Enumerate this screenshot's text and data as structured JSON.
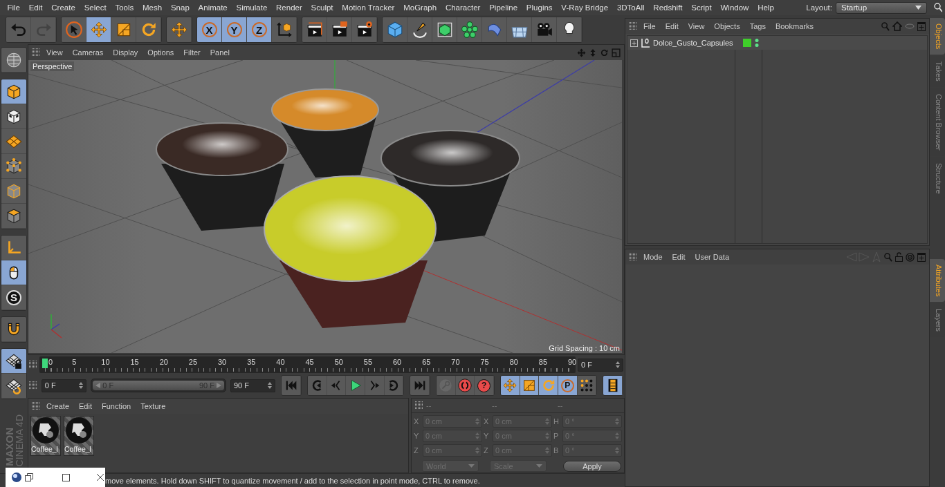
{
  "menu_bar": {
    "items": [
      "File",
      "Edit",
      "Create",
      "Select",
      "Tools",
      "Mesh",
      "Snap",
      "Animate",
      "Simulate",
      "Render",
      "Sculpt",
      "Motion Tracker",
      "MoGraph",
      "Character",
      "Pipeline",
      "Plugins",
      "V-Ray Bridge",
      "3DToAll",
      "Redshift",
      "Script",
      "Window",
      "Help"
    ],
    "layout_label": "Layout:",
    "layout_value": "Startup"
  },
  "toolbar": {
    "groups": [
      {
        "tools": [
          {
            "kind": "undo",
            "selected": false,
            "disabled": false
          },
          {
            "kind": "redo",
            "selected": false,
            "disabled": true
          }
        ]
      },
      {
        "tools": [
          {
            "kind": "pointer",
            "selected": false,
            "disabled": false
          },
          {
            "kind": "move",
            "selected": true,
            "disabled": false
          },
          {
            "kind": "scale",
            "selected": false,
            "disabled": false
          },
          {
            "kind": "rotate",
            "selected": false,
            "disabled": false
          }
        ]
      },
      {
        "tools": [
          {
            "kind": "move-alt",
            "selected": false,
            "disabled": false
          }
        ]
      },
      {
        "tools": [
          {
            "kind": "axis-lock",
            "label": "X",
            "selected": true,
            "disabled": false
          },
          {
            "kind": "axis-lock",
            "label": "Y",
            "selected": true,
            "disabled": false
          },
          {
            "kind": "axis-lock",
            "label": "Z",
            "selected": true,
            "disabled": false
          },
          {
            "kind": "coord-system",
            "selected": false,
            "disabled": false
          }
        ]
      },
      {
        "tools": [
          {
            "kind": "render-view",
            "selected": false,
            "disabled": false
          },
          {
            "kind": "render-picture",
            "selected": false,
            "disabled": false
          },
          {
            "kind": "render-settings",
            "selected": false,
            "disabled": false
          }
        ]
      },
      {
        "tools": [
          {
            "kind": "cube",
            "selected": false,
            "disabled": false
          },
          {
            "kind": "pen",
            "selected": false,
            "disabled": false
          },
          {
            "kind": "subdivision",
            "selected": false,
            "disabled": false
          },
          {
            "kind": "cloner",
            "selected": false,
            "disabled": false
          },
          {
            "kind": "deformer",
            "selected": false,
            "disabled": false
          },
          {
            "kind": "floor",
            "selected": false,
            "disabled": false
          },
          {
            "kind": "camera",
            "selected": false,
            "disabled": false
          },
          {
            "kind": "light",
            "selected": false,
            "disabled": false
          }
        ]
      }
    ]
  },
  "mode_strip": {
    "groups": [
      {
        "tools": [
          {
            "kind": "sphere-grid",
            "selected": false
          }
        ]
      },
      {
        "tools": [
          {
            "kind": "model",
            "selected": true
          },
          {
            "kind": "texture",
            "selected": false
          },
          {
            "kind": "workplane",
            "selected": false
          },
          {
            "kind": "points",
            "selected": false
          },
          {
            "kind": "edges",
            "selected": false
          },
          {
            "kind": "polygons",
            "selected": false
          }
        ]
      },
      {
        "tools": [
          {
            "kind": "axis",
            "selected": false
          },
          {
            "kind": "tweak",
            "selected": true
          },
          {
            "kind": "solo",
            "label": "S",
            "selected": false
          }
        ]
      },
      {
        "tools": [
          {
            "kind": "magnet",
            "selected": false
          }
        ]
      },
      {
        "tools": [
          {
            "kind": "lock-grid",
            "selected": true
          },
          {
            "kind": "snap-grid",
            "selected": false
          }
        ]
      }
    ]
  },
  "logo": {
    "brand": "MAXON",
    "product": "CINEMA 4D"
  },
  "viewport": {
    "menu": [
      "View",
      "Cameras",
      "Display",
      "Options",
      "Filter",
      "Panel"
    ],
    "view_label": "Perspective",
    "grid_spacing": "Grid Spacing : 10 cm"
  },
  "timeline": {
    "ticks": [
      "0",
      "5",
      "10",
      "15",
      "20",
      "25",
      "30",
      "35",
      "40",
      "45",
      "50",
      "55",
      "60",
      "65",
      "70",
      "75",
      "80",
      "85",
      "90"
    ],
    "level": 0,
    "current_frame": "0 F"
  },
  "transport": {
    "start": "0 F",
    "range": {
      "start": "0 F",
      "end": "90 F",
      "level": 1
    },
    "end": "90 F",
    "groups": [
      {
        "buttons": [
          {
            "kind": "go-start",
            "selected": false,
            "disabled": false
          }
        ]
      },
      {
        "buttons": [
          {
            "kind": "prev-key",
            "selected": false,
            "disabled": false
          },
          {
            "kind": "prev-frame",
            "selected": false,
            "disabled": false
          },
          {
            "kind": "play",
            "selected": false,
            "disabled": false
          },
          {
            "kind": "next-frame",
            "selected": false,
            "disabled": false
          },
          {
            "kind": "next-key",
            "selected": false,
            "disabled": false
          }
        ]
      },
      {
        "buttons": [
          {
            "kind": "go-end",
            "selected": false,
            "disabled": false
          }
        ]
      },
      {
        "buttons": [
          {
            "kind": "record",
            "selected": false,
            "disabled": true
          },
          {
            "kind": "autokey",
            "selected": false,
            "disabled": false
          },
          {
            "kind": "key-selection",
            "label": "?",
            "selected": false,
            "disabled": false
          }
        ]
      },
      {
        "buttons": [
          {
            "kind": "move",
            "selected": true,
            "disabled": false
          },
          {
            "kind": "scale",
            "selected": true,
            "disabled": false
          },
          {
            "kind": "rotate",
            "selected": true,
            "disabled": false
          },
          {
            "kind": "param-lock",
            "label": "P",
            "selected": true,
            "disabled": false
          },
          {
            "kind": "dots",
            "selected": false,
            "disabled": false
          }
        ]
      },
      {
        "buttons": [
          {
            "kind": "film",
            "selected": true,
            "disabled": false
          }
        ]
      }
    ]
  },
  "materials": {
    "menu": [
      "Create",
      "Edit",
      "Function",
      "Texture"
    ],
    "items": [
      {
        "name": "Coffee_l"
      },
      {
        "name": "Coffee_l"
      }
    ]
  },
  "coordinates": {
    "headers": [
      "--",
      "--",
      "--"
    ],
    "columns": [
      {
        "fields": [
          {
            "label": "X",
            "value": "0 cm"
          },
          {
            "label": "Y",
            "value": "0 cm"
          },
          {
            "label": "Z",
            "value": "0 cm"
          }
        ]
      },
      {
        "fields": [
          {
            "label": "X",
            "value": "0 cm"
          },
          {
            "label": "Y",
            "value": "0 cm"
          },
          {
            "label": "Z",
            "value": "0 cm"
          }
        ]
      },
      {
        "fields": [
          {
            "label": "H",
            "value": "0 °"
          },
          {
            "label": "P",
            "value": "0 °"
          },
          {
            "label": "B",
            "value": "0 °"
          }
        ]
      }
    ],
    "space_dropdown": "World",
    "size_dropdown": "Scale",
    "apply_button": "Apply"
  },
  "status_bar": {
    "text": "move elements. Hold down SHIFT to quantize movement / add to the selection in point mode, CTRL to remove."
  },
  "object_manager": {
    "menu": [
      "File",
      "Edit",
      "View",
      "Objects",
      "Tags",
      "Bookmarks"
    ],
    "objects": [
      {
        "name": "Dolce_Gusto_Capsules",
        "expanded": false
      }
    ]
  },
  "attributes": {
    "menu": [
      "Mode",
      "Edit",
      "User Data"
    ]
  },
  "side_tabs_top": [
    {
      "label": "Objects",
      "selected": true
    },
    {
      "label": "Takes",
      "selected": false
    },
    {
      "label": "Content Browser",
      "selected": false
    },
    {
      "label": "Structure",
      "selected": false
    }
  ],
  "side_tabs_bottom": [
    {
      "label": "Attributes",
      "selected": true
    },
    {
      "label": "Layers",
      "selected": false
    }
  ]
}
